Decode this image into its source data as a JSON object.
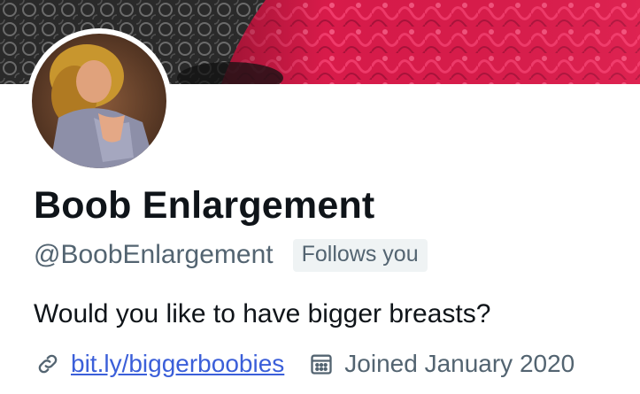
{
  "profile": {
    "display_name": "Boob Enlargement",
    "handle": "@BoobEnlargement",
    "follows_badge": "Follows you",
    "bio": "Would you like to have bigger breasts?",
    "website": "bit.ly/biggerboobies",
    "joined": "Joined January 2020"
  },
  "icons": {
    "link": "link-icon",
    "calendar": "calendar-icon"
  },
  "colors": {
    "banner_accent": "#d81b4a",
    "link": "#3b5fd9",
    "secondary_text": "#536471",
    "badge_bg": "#eff3f4"
  }
}
